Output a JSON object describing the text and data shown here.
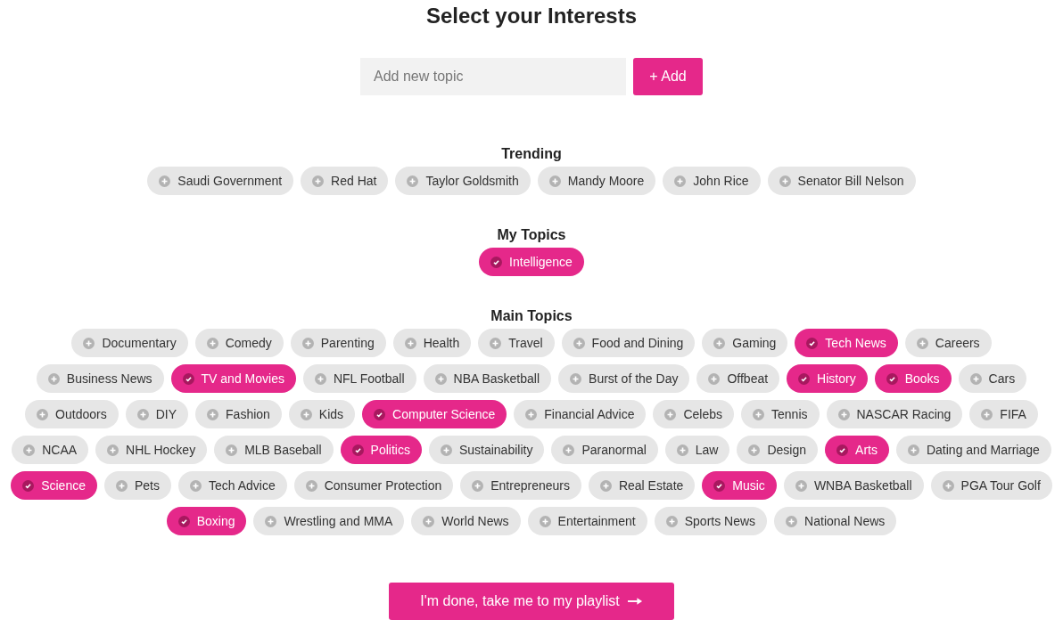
{
  "title": "Select your Interests",
  "new_topic": {
    "placeholder": "Add new topic",
    "button": "+ Add"
  },
  "sections": [
    {
      "heading": "Trending",
      "topics": [
        {
          "label": "Saudi Government",
          "selected": false
        },
        {
          "label": "Red Hat",
          "selected": false
        },
        {
          "label": "Taylor Goldsmith",
          "selected": false
        },
        {
          "label": "Mandy Moore",
          "selected": false
        },
        {
          "label": "John Rice",
          "selected": false
        },
        {
          "label": "Senator Bill Nelson",
          "selected": false
        }
      ]
    },
    {
      "heading": "My Topics",
      "topics": [
        {
          "label": "Intelligence",
          "selected": true
        }
      ]
    },
    {
      "heading": "Main Topics",
      "topics": [
        {
          "label": "Documentary",
          "selected": false
        },
        {
          "label": "Comedy",
          "selected": false
        },
        {
          "label": "Parenting",
          "selected": false
        },
        {
          "label": "Health",
          "selected": false
        },
        {
          "label": "Travel",
          "selected": false
        },
        {
          "label": "Food and Dining",
          "selected": false
        },
        {
          "label": "Gaming",
          "selected": false
        },
        {
          "label": "Tech News",
          "selected": true
        },
        {
          "label": "Careers",
          "selected": false
        },
        {
          "label": "Business News",
          "selected": false
        },
        {
          "label": "TV and Movies",
          "selected": true
        },
        {
          "label": "NFL Football",
          "selected": false
        },
        {
          "label": "NBA Basketball",
          "selected": false
        },
        {
          "label": "Burst of the Day",
          "selected": false
        },
        {
          "label": "Offbeat",
          "selected": false
        },
        {
          "label": "History",
          "selected": true
        },
        {
          "label": "Books",
          "selected": true
        },
        {
          "label": "Cars",
          "selected": false
        },
        {
          "label": "Outdoors",
          "selected": false
        },
        {
          "label": "DIY",
          "selected": false
        },
        {
          "label": "Fashion",
          "selected": false
        },
        {
          "label": "Kids",
          "selected": false
        },
        {
          "label": "Computer Science",
          "selected": true
        },
        {
          "label": "Financial Advice",
          "selected": false
        },
        {
          "label": "Celebs",
          "selected": false
        },
        {
          "label": "Tennis",
          "selected": false
        },
        {
          "label": "NASCAR Racing",
          "selected": false
        },
        {
          "label": "FIFA",
          "selected": false
        },
        {
          "label": "NCAA",
          "selected": false
        },
        {
          "label": "NHL Hockey",
          "selected": false
        },
        {
          "label": "MLB Baseball",
          "selected": false
        },
        {
          "label": "Politics",
          "selected": true
        },
        {
          "label": "Sustainability",
          "selected": false
        },
        {
          "label": "Paranormal",
          "selected": false
        },
        {
          "label": "Law",
          "selected": false
        },
        {
          "label": "Design",
          "selected": false
        },
        {
          "label": "Arts",
          "selected": true
        },
        {
          "label": "Dating and Marriage",
          "selected": false
        },
        {
          "label": "Science",
          "selected": true
        },
        {
          "label": "Pets",
          "selected": false
        },
        {
          "label": "Tech Advice",
          "selected": false
        },
        {
          "label": "Consumer Protection",
          "selected": false
        },
        {
          "label": "Entrepreneurs",
          "selected": false
        },
        {
          "label": "Real Estate",
          "selected": false
        },
        {
          "label": "Music",
          "selected": true
        },
        {
          "label": "WNBA Basketball",
          "selected": false
        },
        {
          "label": "PGA Tour Golf",
          "selected": false
        },
        {
          "label": "Boxing",
          "selected": true
        },
        {
          "label": "Wrestling and MMA",
          "selected": false
        },
        {
          "label": "World News",
          "selected": false
        },
        {
          "label": "Entertainment",
          "selected": false
        },
        {
          "label": "Sports News",
          "selected": false
        },
        {
          "label": "National News",
          "selected": false
        }
      ]
    }
  ],
  "done_button": "I'm done, take me to my playlist"
}
